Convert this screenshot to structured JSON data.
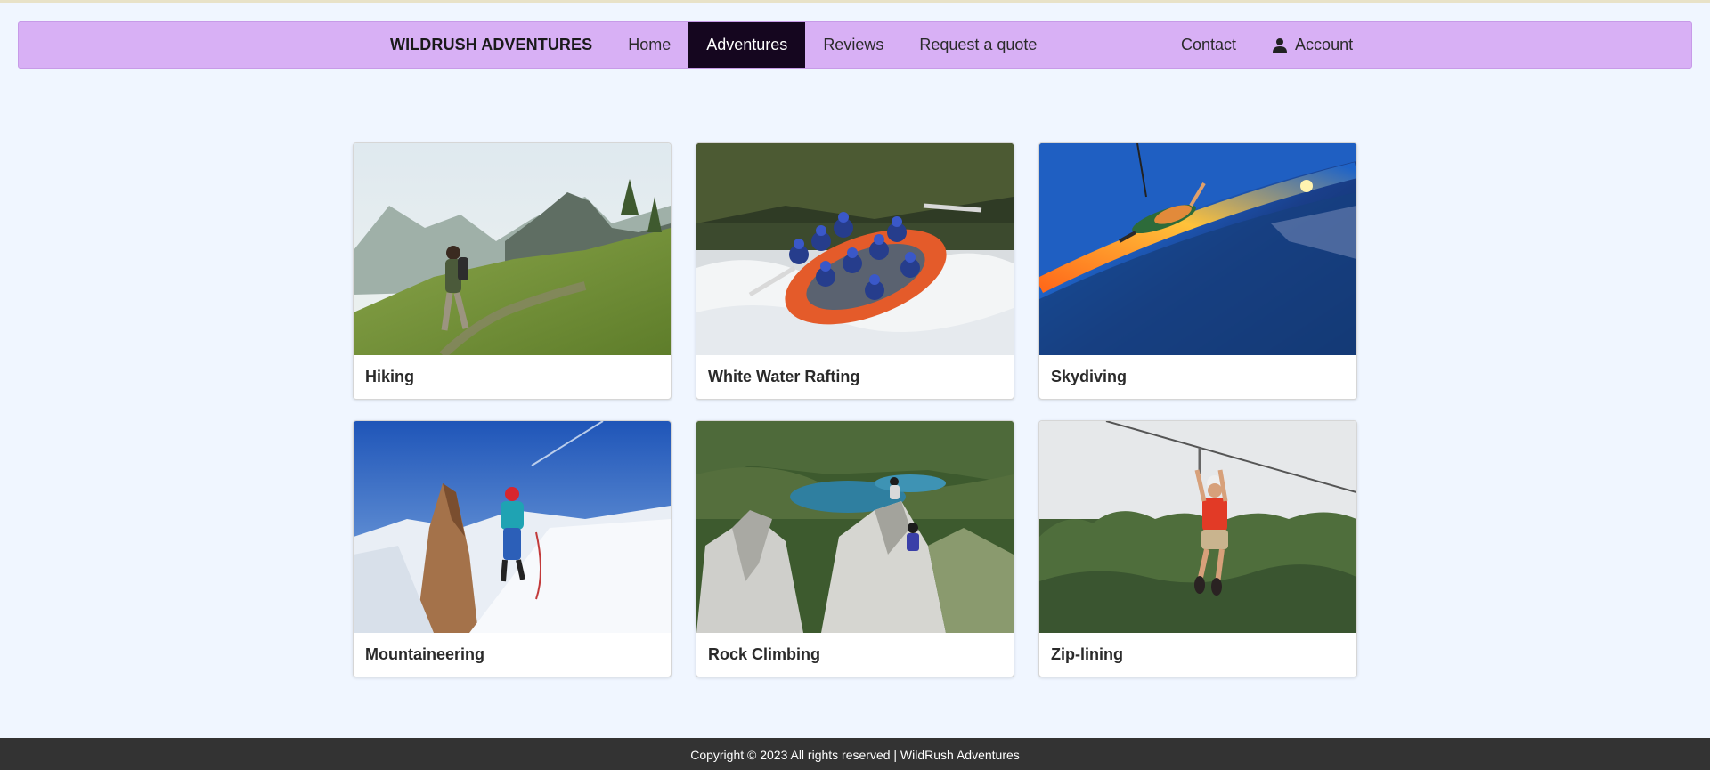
{
  "nav": {
    "brand": "WILDRUSH ADVENTURES",
    "links": [
      {
        "label": "Home"
      },
      {
        "label": "Adventures",
        "active": true
      },
      {
        "label": "Reviews"
      },
      {
        "label": "Request a quote"
      }
    ],
    "right_links": [
      {
        "label": "Contact"
      },
      {
        "label": "Account",
        "icon": "user-icon"
      }
    ],
    "bar_color": "#d8b0f5",
    "active_color": "#15061f"
  },
  "adventures": [
    {
      "title": "Hiking",
      "image": "hiking-photo"
    },
    {
      "title": "White Water Rafting",
      "image": "rafting-photo"
    },
    {
      "title": "Skydiving",
      "image": "skydiving-photo"
    },
    {
      "title": "Mountaineering",
      "image": "mountaineering-photo"
    },
    {
      "title": "Rock Climbing",
      "image": "rock-climbing-photo"
    },
    {
      "title": "Zip-lining",
      "image": "zip-lining-photo"
    }
  ],
  "footer": {
    "text": "Copyright © 2023 All rights reserved | WildRush Adventures"
  }
}
